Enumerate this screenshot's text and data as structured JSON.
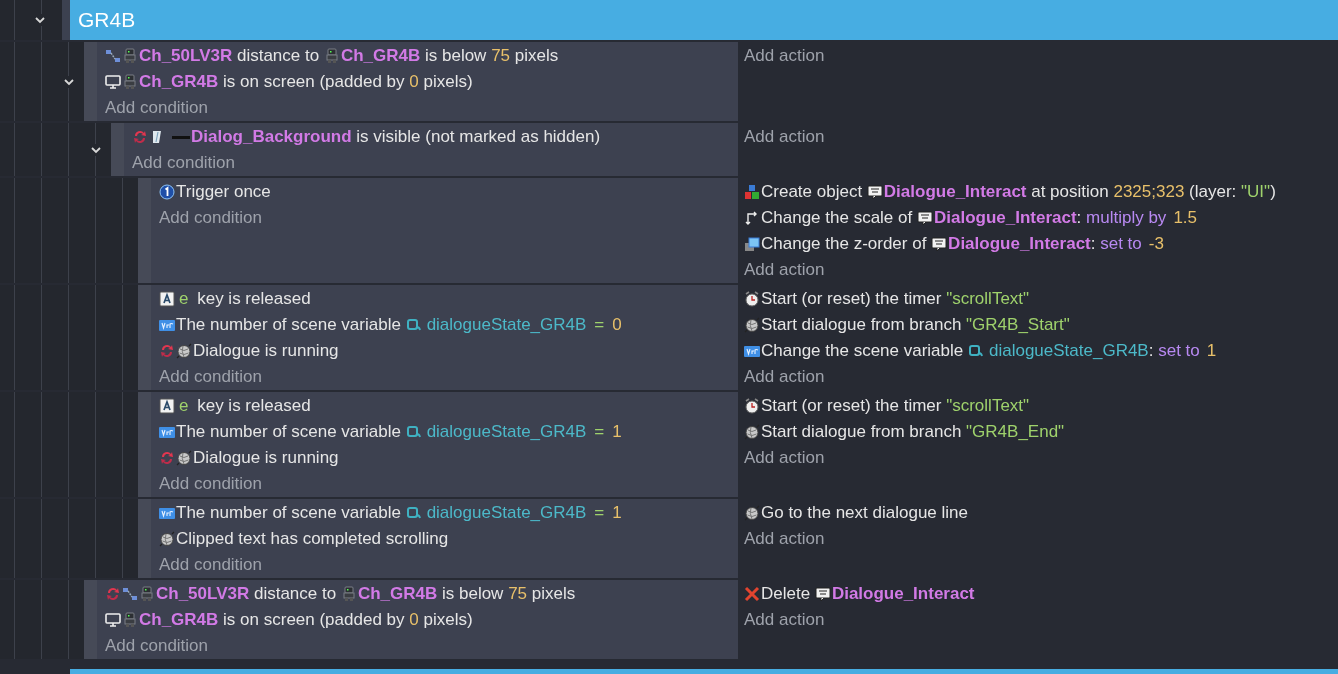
{
  "group": {
    "title": "GR4B",
    "expanded": true
  },
  "events": [
    {
      "expanded": true,
      "add_condition": "Add condition",
      "add_action": "Add action",
      "conditions": [
        {
          "parts": [
            {
              "kind": "distance"
            },
            {
              "kind": "robot"
            },
            {
              "kind": "object",
              "text": "Ch_50LV3R"
            },
            {
              "kind": "text",
              "text": " distance to "
            },
            {
              "kind": "robot"
            },
            {
              "kind": "object",
              "text": "Ch_GR4B"
            },
            {
              "kind": "text",
              "text": " is below "
            },
            {
              "kind": "number",
              "text": "75"
            },
            {
              "kind": "text",
              "text": " pixels"
            }
          ]
        },
        {
          "parts": [
            {
              "kind": "screen"
            },
            {
              "kind": "robot"
            },
            {
              "kind": "object",
              "text": "Ch_GR4B"
            },
            {
              "kind": "text",
              "text": " is on screen (padded by "
            },
            {
              "kind": "number",
              "text": "0"
            },
            {
              "kind": "text",
              "text": " pixels)"
            }
          ]
        }
      ],
      "children": [
        {
          "expanded": true,
          "add_condition": "Add condition",
          "add_action": "Add action",
          "conditions": [
            {
              "parts": [
                {
                  "kind": "invert"
                },
                {
                  "kind": "sprite"
                },
                {
                  "kind": "bar"
                },
                {
                  "kind": "object",
                  "text": "Dialog_Background"
                },
                {
                  "kind": "text",
                  "text": " is visible (not marked as hidden)"
                }
              ]
            }
          ],
          "children": [
            {
              "add_condition": "Add condition",
              "add_action": "Add action",
              "conditions": [
                {
                  "parts": [
                    {
                      "kind": "once"
                    },
                    {
                      "kind": "text",
                      "text": "Trigger once"
                    }
                  ]
                }
              ],
              "actions": [
                {
                  "parts": [
                    {
                      "kind": "create"
                    },
                    {
                      "kind": "text",
                      "text": "Create object "
                    },
                    {
                      "kind": "textobj"
                    },
                    {
                      "kind": "object",
                      "text": "Dialogue_Interact"
                    },
                    {
                      "kind": "text",
                      "text": " at position "
                    },
                    {
                      "kind": "number",
                      "text": "2325;323"
                    },
                    {
                      "kind": "text",
                      "text": " (layer: "
                    },
                    {
                      "kind": "string",
                      "text": "\"UI\""
                    },
                    {
                      "kind": "text",
                      "text": ")"
                    }
                  ]
                },
                {
                  "parts": [
                    {
                      "kind": "scale"
                    },
                    {
                      "kind": "text",
                      "text": "Change the scale of "
                    },
                    {
                      "kind": "textobj"
                    },
                    {
                      "kind": "object",
                      "text": "Dialogue_Interact"
                    },
                    {
                      "kind": "text",
                      "text": ": "
                    },
                    {
                      "kind": "operator",
                      "text": "multiply by"
                    },
                    {
                      "kind": "number",
                      "text": "1.5"
                    }
                  ]
                },
                {
                  "parts": [
                    {
                      "kind": "zorder"
                    },
                    {
                      "kind": "text",
                      "text": "Change the z-order of "
                    },
                    {
                      "kind": "textobj"
                    },
                    {
                      "kind": "object",
                      "text": "Dialogue_Interact"
                    },
                    {
                      "kind": "text",
                      "text": ": "
                    },
                    {
                      "kind": "operator",
                      "text": "set to"
                    },
                    {
                      "kind": "number",
                      "text": "-3"
                    }
                  ]
                }
              ]
            },
            {
              "add_condition": "Add condition",
              "add_action": "Add action",
              "conditions": [
                {
                  "parts": [
                    {
                      "kind": "keyboard"
                    },
                    {
                      "kind": "key",
                      "text": "e"
                    },
                    {
                      "kind": "text",
                      "text": " key is released"
                    }
                  ]
                },
                {
                  "parts": [
                    {
                      "kind": "var"
                    },
                    {
                      "kind": "text",
                      "text": "The number of scene variable "
                    },
                    {
                      "kind": "scenevar"
                    },
                    {
                      "kind": "variable",
                      "text": "dialogueState_GR4B"
                    },
                    {
                      "kind": "equals",
                      "text": "="
                    },
                    {
                      "kind": "number",
                      "text": "0"
                    }
                  ]
                },
                {
                  "parts": [
                    {
                      "kind": "invert"
                    },
                    {
                      "kind": "yarn"
                    },
                    {
                      "kind": "text",
                      "text": "Dialogue is running"
                    }
                  ]
                }
              ],
              "actions": [
                {
                  "parts": [
                    {
                      "kind": "timer"
                    },
                    {
                      "kind": "text",
                      "text": "Start (or reset) the timer "
                    },
                    {
                      "kind": "string",
                      "text": "\"scrollText\""
                    }
                  ]
                },
                {
                  "parts": [
                    {
                      "kind": "yarn"
                    },
                    {
                      "kind": "text",
                      "text": "Start dialogue from branch "
                    },
                    {
                      "kind": "string",
                      "text": "\"GR4B_Start\""
                    }
                  ]
                },
                {
                  "parts": [
                    {
                      "kind": "var"
                    },
                    {
                      "kind": "text",
                      "text": "Change the scene variable "
                    },
                    {
                      "kind": "scenevar"
                    },
                    {
                      "kind": "variable",
                      "text": "dialogueState_GR4B"
                    },
                    {
                      "kind": "text",
                      "text": ": "
                    },
                    {
                      "kind": "operator",
                      "text": "set to"
                    },
                    {
                      "kind": "number",
                      "text": "1"
                    }
                  ]
                }
              ]
            },
            {
              "add_condition": "Add condition",
              "add_action": "Add action",
              "conditions": [
                {
                  "parts": [
                    {
                      "kind": "keyboard"
                    },
                    {
                      "kind": "key",
                      "text": "e"
                    },
                    {
                      "kind": "text",
                      "text": " key is released"
                    }
                  ]
                },
                {
                  "parts": [
                    {
                      "kind": "var"
                    },
                    {
                      "kind": "text",
                      "text": "The number of scene variable "
                    },
                    {
                      "kind": "scenevar"
                    },
                    {
                      "kind": "variable",
                      "text": "dialogueState_GR4B"
                    },
                    {
                      "kind": "equals",
                      "text": "="
                    },
                    {
                      "kind": "number",
                      "text": "1"
                    }
                  ]
                },
                {
                  "parts": [
                    {
                      "kind": "invert"
                    },
                    {
                      "kind": "yarn"
                    },
                    {
                      "kind": "text",
                      "text": "Dialogue is running"
                    }
                  ]
                }
              ],
              "actions": [
                {
                  "parts": [
                    {
                      "kind": "timer"
                    },
                    {
                      "kind": "text",
                      "text": "Start (or reset) the timer "
                    },
                    {
                      "kind": "string",
                      "text": "\"scrollText\""
                    }
                  ]
                },
                {
                  "parts": [
                    {
                      "kind": "yarn"
                    },
                    {
                      "kind": "text",
                      "text": "Start dialogue from branch "
                    },
                    {
                      "kind": "string",
                      "text": "\"GR4B_End\""
                    }
                  ]
                }
              ]
            },
            {
              "add_condition": "Add condition",
              "add_action": "Add action",
              "conditions": [
                {
                  "parts": [
                    {
                      "kind": "var"
                    },
                    {
                      "kind": "text",
                      "text": "The number of scene variable "
                    },
                    {
                      "kind": "scenevar"
                    },
                    {
                      "kind": "variable",
                      "text": "dialogueState_GR4B"
                    },
                    {
                      "kind": "equals",
                      "text": "="
                    },
                    {
                      "kind": "number",
                      "text": "1"
                    }
                  ]
                },
                {
                  "parts": [
                    {
                      "kind": "yarn"
                    },
                    {
                      "kind": "text",
                      "text": "Clipped text has completed scrolling"
                    }
                  ]
                }
              ],
              "actions": [
                {
                  "parts": [
                    {
                      "kind": "yarn"
                    },
                    {
                      "kind": "text",
                      "text": "Go to the next dialogue line"
                    }
                  ]
                }
              ]
            }
          ]
        }
      ]
    },
    {
      "add_condition": "Add condition",
      "add_action": "Add action",
      "conditions": [
        {
          "parts": [
            {
              "kind": "invert"
            },
            {
              "kind": "distance"
            },
            {
              "kind": "robot"
            },
            {
              "kind": "object",
              "text": "Ch_50LV3R"
            },
            {
              "kind": "text",
              "text": " distance to "
            },
            {
              "kind": "robot"
            },
            {
              "kind": "object",
              "text": "Ch_GR4B"
            },
            {
              "kind": "text",
              "text": " is below "
            },
            {
              "kind": "number",
              "text": "75"
            },
            {
              "kind": "text",
              "text": " pixels"
            }
          ]
        },
        {
          "parts": [
            {
              "kind": "screen"
            },
            {
              "kind": "robot"
            },
            {
              "kind": "object",
              "text": "Ch_GR4B"
            },
            {
              "kind": "text",
              "text": " is on screen (padded by "
            },
            {
              "kind": "number",
              "text": "0"
            },
            {
              "kind": "text",
              "text": " pixels)"
            }
          ]
        }
      ],
      "actions": [
        {
          "parts": [
            {
              "kind": "delete"
            },
            {
              "kind": "text",
              "text": "Delete "
            },
            {
              "kind": "textobj"
            },
            {
              "kind": "object",
              "text": "Dialogue_Interact"
            }
          ]
        }
      ]
    }
  ]
}
